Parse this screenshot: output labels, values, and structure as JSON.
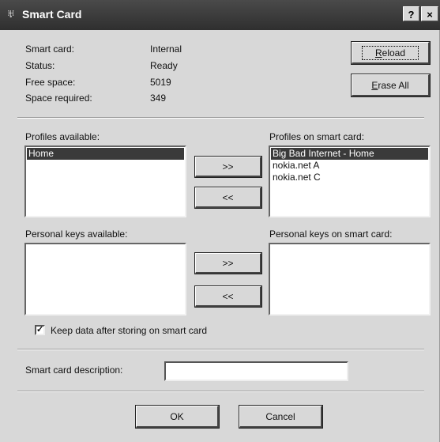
{
  "window": {
    "title": "Smart Card",
    "help_label": "?",
    "close_label": "×"
  },
  "info": {
    "smart_card_label": "Smart card:",
    "smart_card_value": "Internal",
    "status_label": "Status:",
    "status_value": "Ready",
    "free_space_label": "Free space:",
    "free_space_value": "5019",
    "space_required_label": "Space required:",
    "space_required_value": "349"
  },
  "buttons": {
    "reload": "Reload",
    "erase_all": "Erase All",
    "add_profile": ">>",
    "remove_profile": "<<",
    "add_key": ">>",
    "remove_key": "<<",
    "ok": "OK",
    "cancel": "Cancel"
  },
  "profiles_available": {
    "label": "Profiles available:",
    "items": [
      "Home"
    ]
  },
  "profiles_on_card": {
    "label": "Profiles on smart card:",
    "items": [
      "Big Bad Internet - Home",
      "nokia.net A",
      "nokia.net C"
    ]
  },
  "keys_available": {
    "label": "Personal keys available:"
  },
  "keys_on_card": {
    "label": "Personal keys on smart card:"
  },
  "keep_data": {
    "label": "Keep data after storing on smart card",
    "checked": true
  },
  "description": {
    "label": "Smart card description:",
    "value": ""
  }
}
